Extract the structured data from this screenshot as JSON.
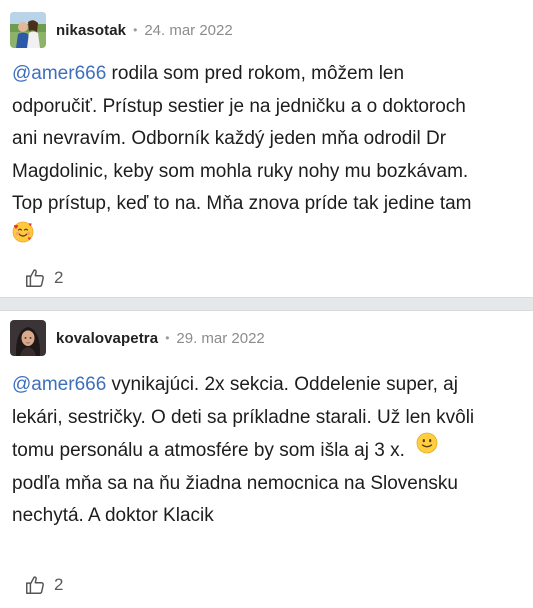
{
  "comments": [
    {
      "username": "nikasotak",
      "separator": "•",
      "date": "24. mar 2022",
      "mention": "@amer666",
      "lines": [
        " rodila som pred rokom, môžem len",
        "odporučiť. Prístup sestier je na jedničku a o doktoroch",
        "ani nevravím. Odborník každý jeden mňa odrodil Dr",
        "Magdolinic, keby som mohla ruky nohy mu bozkávam.",
        "Top prístup, keď to na. Mňa znova príde tak jedine tam"
      ],
      "trailing_emoji": "smiling-face-with-hearts",
      "likes": "2"
    },
    {
      "username": "kovalovapetra",
      "separator": "•",
      "date": "29. mar 2022",
      "mention": "@amer666",
      "lines": [
        " vynikajúci. 2x sekcia. Oddelenie super, aj",
        "lekári, sestričky. O deti sa príkladne starali. Už len kvôli",
        "tomu personálu a atmosfére by som išla aj 3 x.",
        "podľa mňa sa na ňu žiadna nemocnica na Slovensku",
        "nechytá. A doktor Klacik"
      ],
      "inline_emoji": "slightly-smiling-face",
      "likes": "2"
    }
  ],
  "colors": {
    "mention": "#3d6fbd",
    "divider": "#e6e7ea",
    "meta": "#8c8c8c"
  }
}
